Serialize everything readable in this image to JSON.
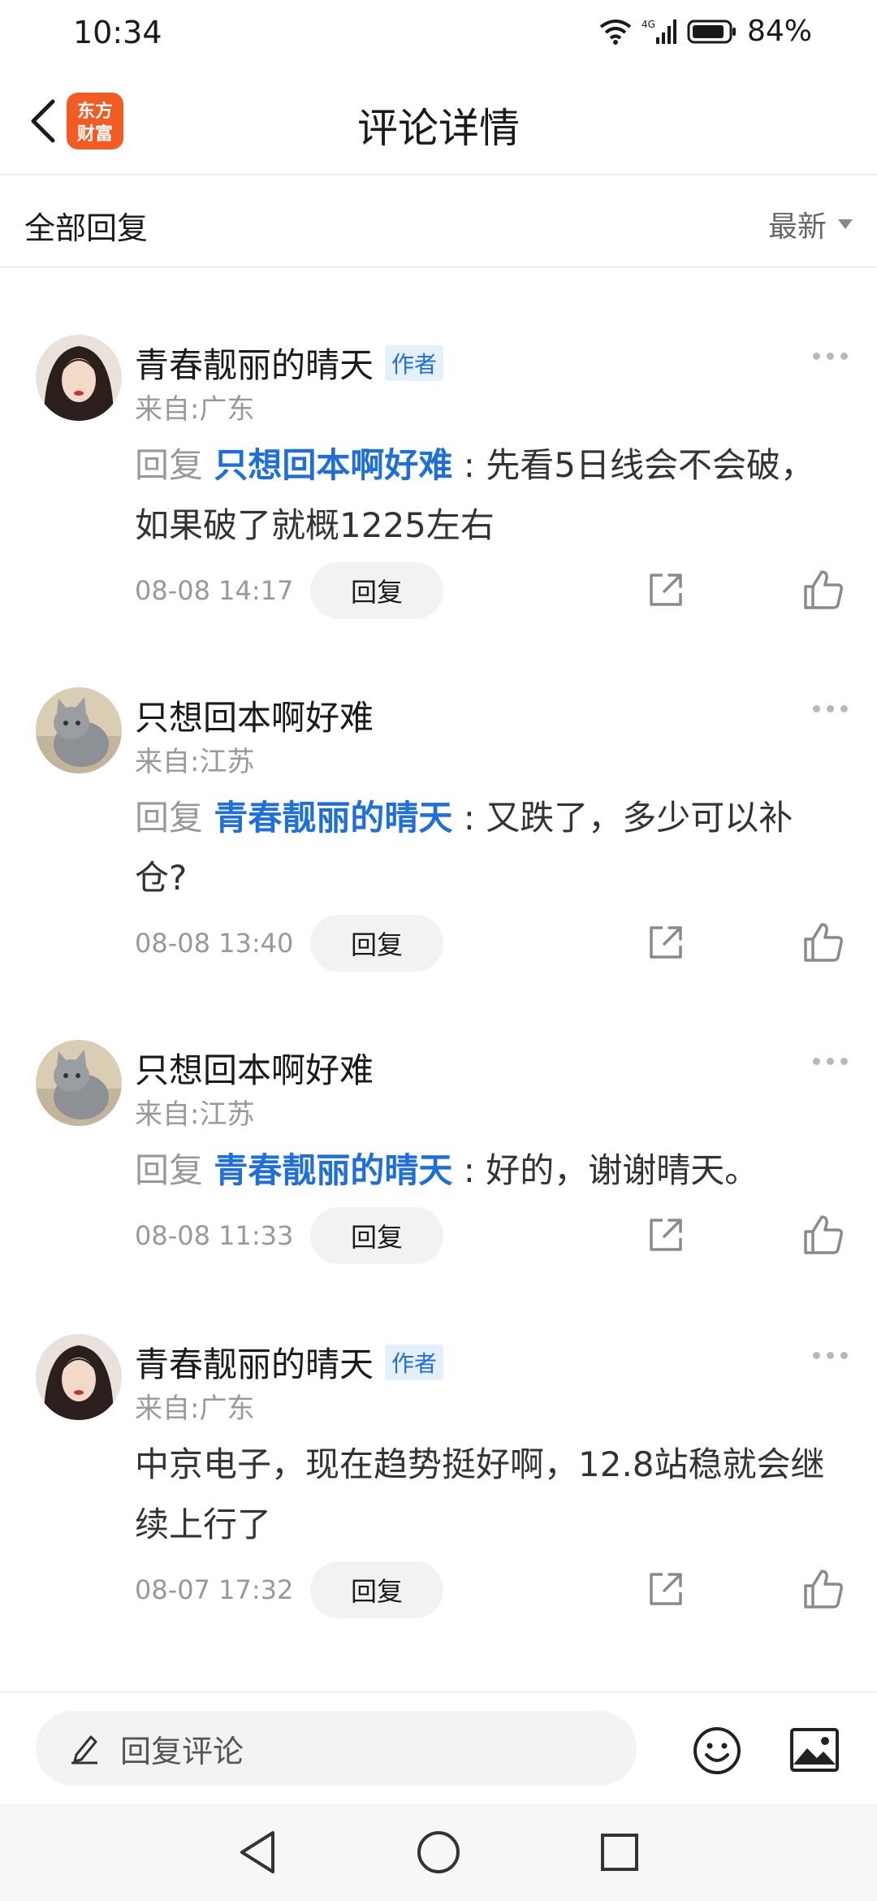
{
  "status_bar": {
    "time": "10:34",
    "network": "4G",
    "battery": "84%"
  },
  "header": {
    "title": "评论详情",
    "logo_line1": "东方",
    "logo_line2": "财富",
    "logo_color": "#f25b22"
  },
  "filter": {
    "title": "全部回复",
    "sort_label": "最新"
  },
  "colors": {
    "mention": "#1e6fd9",
    "muted": "#999999"
  },
  "comments": [
    {
      "username": "青春靓丽的晴天",
      "badge": "作者",
      "location": "来自:广东",
      "reply_prefix": "回复",
      "mention": "只想回本啊好难",
      "separator": ":",
      "text": "先看5日线会不会破，如果破了就概1225左右",
      "time": "08-08 14:17",
      "reply_label": "回复"
    },
    {
      "username": "只想回本啊好难",
      "badge": "",
      "location": "来自:江苏",
      "reply_prefix": "回复",
      "mention": "青春靓丽的晴天",
      "separator": ":",
      "text": "又跌了，多少可以补仓?",
      "time": "08-08 13:40",
      "reply_label": "回复"
    },
    {
      "username": "只想回本啊好难",
      "badge": "",
      "location": "来自:江苏",
      "reply_prefix": "回复",
      "mention": "青春靓丽的晴天",
      "separator": ":",
      "text": "好的，谢谢晴天。",
      "time": "08-08 11:33",
      "reply_label": "回复"
    },
    {
      "username": "青春靓丽的晴天",
      "badge": "作者",
      "location": "来自:广东",
      "reply_prefix": "",
      "mention": "",
      "separator": "",
      "text": "中京电子，现在趋势挺好啊，12.8站稳就会继续上行了",
      "time": "08-07 17:32",
      "reply_label": "回复"
    }
  ],
  "input_bar": {
    "placeholder": "回复评论"
  }
}
